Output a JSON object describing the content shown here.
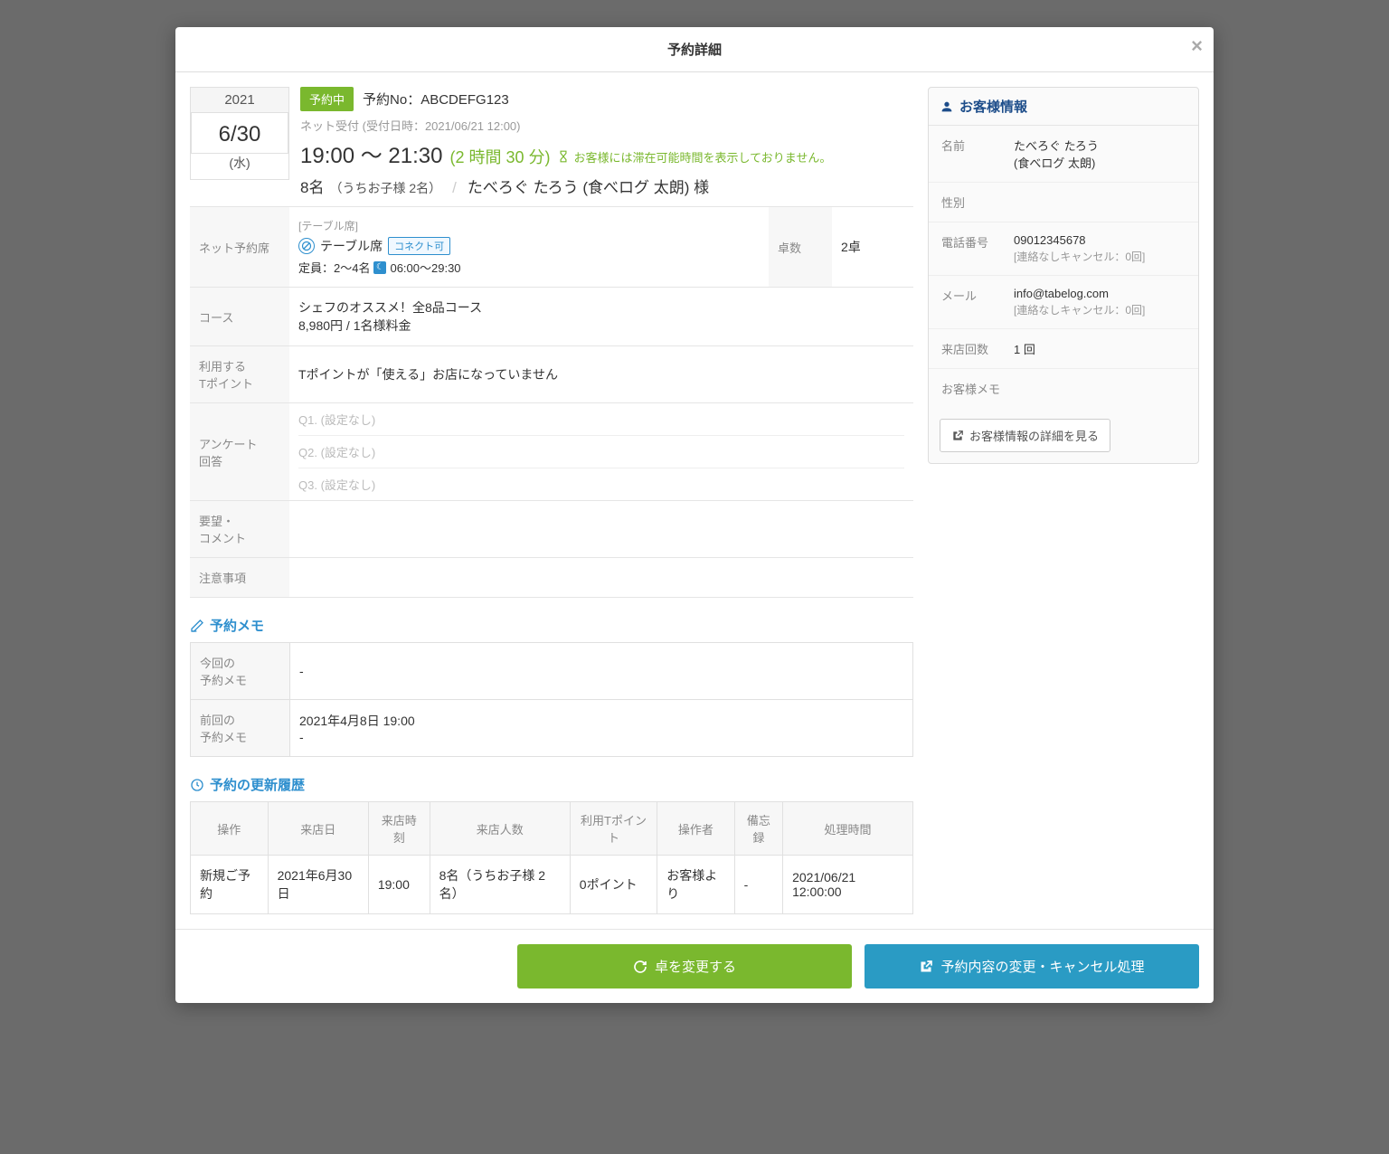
{
  "modal_title": "予約詳細",
  "date_box": {
    "year": "2021",
    "md": "6/30",
    "dow": "(水)"
  },
  "summary": {
    "status_badge": "予約中",
    "res_no": "予約No：ABCDEFG123",
    "net_accept": "ネット受付 (受付日時：2021/06/21 12:00)",
    "time_range": "19:00 〜 21:30",
    "duration": "(2 時間 30 分)",
    "warn": "お客様には滞在可能時間を表示しておりません。",
    "party_count": "8名",
    "party_child": "（うちお子様 2名）",
    "party_name": "たべろぐ たろう (食べログ 太朗) 様"
  },
  "details": {
    "net_seat_label": "ネット予約席",
    "seat_category": "[テーブル席]",
    "seat_type": "テーブル席",
    "connect_chip": "コネクト可",
    "capacity": "定員：2〜4名",
    "hours": "06:00〜29:30",
    "table_count_label": "卓数",
    "table_count": "2卓",
    "course_label": "コース",
    "course_name": "シェフのオススメ！全8品コース",
    "course_price": "8,980円 / 1名様料金",
    "tpoint_label": "利用する\nTポイント",
    "tpoint_text": "Tポイントが「使える」お店になっていません",
    "survey_label": "アンケート\n回答",
    "survey": [
      "Q1. (設定なし)",
      "Q2. (設定なし)",
      "Q3. (設定なし)"
    ],
    "request_label": "要望・\nコメント",
    "notes_label": "注意事項"
  },
  "memo": {
    "section_title": "予約メモ",
    "this_label": "今回の\n予約メモ",
    "this_val": "-",
    "prev_label": "前回の\n予約メモ",
    "prev_date": "2021年4月8日 19:00",
    "prev_val": "-"
  },
  "history": {
    "section_title": "予約の更新履歴",
    "headers": [
      "操作",
      "来店日",
      "来店時刻",
      "来店人数",
      "利用Tポイント",
      "操作者",
      "備忘録",
      "処理時間"
    ],
    "row": {
      "op": "新規ご予約",
      "date": "2021年6月30日",
      "time": "19:00",
      "party": "8名（うちお子様 2名）",
      "tpoint": "0ポイント",
      "operator": "お客様より",
      "memo": "-",
      "processed": "2021/06/21 12:00:00"
    }
  },
  "customer": {
    "panel_title": "お客様情報",
    "name_label": "名前",
    "name": "たべろぐ たろう",
    "name_sub": "(食べログ 太朗)",
    "gender_label": "性別",
    "phone_label": "電話番号",
    "phone": "09012345678",
    "phone_sub": "[連絡なしキャンセル：0回]",
    "email_label": "メール",
    "email": "info@tabelog.com",
    "email_sub": "[連絡なしキャンセル：0回]",
    "visits_label": "来店回数",
    "visits": "1 回",
    "memo_label": "お客様メモ",
    "detail_btn": "お客様情報の詳細を見る"
  },
  "footer": {
    "change_table": "卓を変更する",
    "edit_cancel": "予約内容の変更・キャンセル処理"
  }
}
